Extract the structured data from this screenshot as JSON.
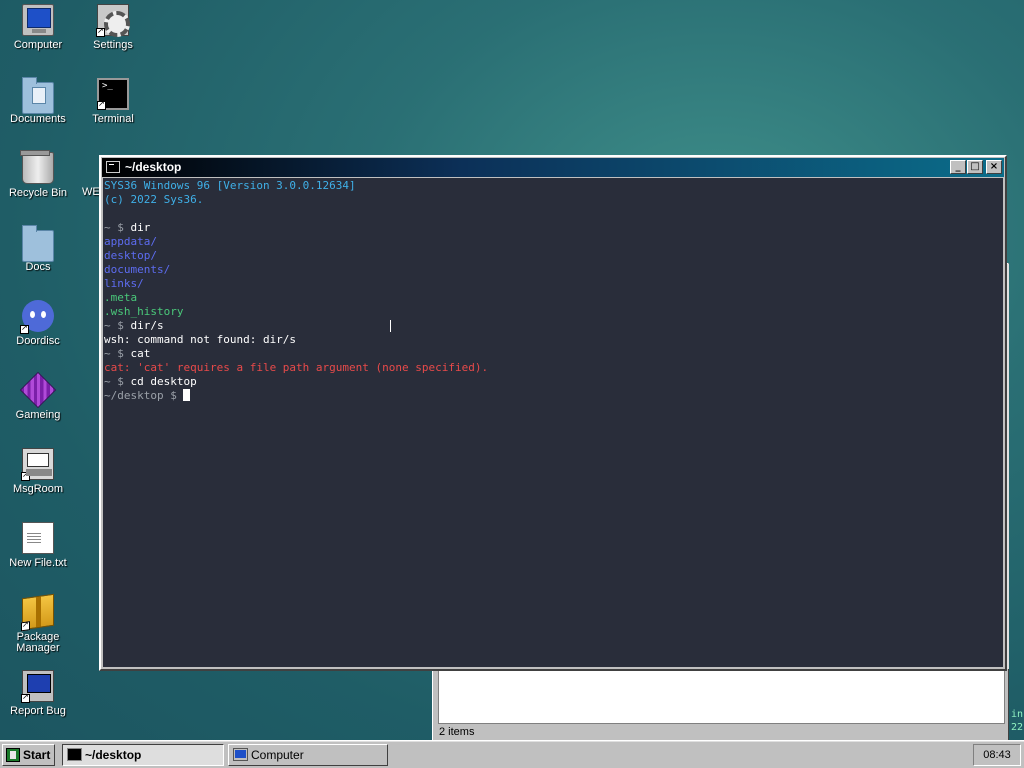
{
  "desktop": {
    "icons": [
      {
        "label": "Computer",
        "icon": "computer-icon"
      },
      {
        "label": "Settings",
        "icon": "settings-icon"
      },
      {
        "label": "Documents",
        "icon": "documents-folder-icon"
      },
      {
        "label": "Terminal",
        "icon": "terminal-icon"
      },
      {
        "label": "Recycle Bin",
        "icon": "recycle-bin-icon"
      },
      {
        "label": "Docs",
        "icon": "folder-icon"
      },
      {
        "label": "Doordisc",
        "icon": "doordisc-icon"
      },
      {
        "label": "Gameing",
        "icon": "game-cube-icon"
      },
      {
        "label": "MsgRoom",
        "icon": "msgroom-icon"
      },
      {
        "label": "New File.txt",
        "icon": "text-file-icon"
      },
      {
        "label": "Package\nManager",
        "icon": "package-icon"
      },
      {
        "label": "Report Bug",
        "icon": "report-bug-icon"
      }
    ],
    "partial_label": "WE",
    "right_edge_text": [
      "in",
      "22"
    ]
  },
  "terminal": {
    "title": "~/desktop",
    "controls": {
      "minimize": "_",
      "maximize": "□",
      "close": "×"
    },
    "lines": [
      {
        "text": "SYS36 Windows 96 [Version 3.0.0.12634]",
        "type": "info"
      },
      {
        "text": "(c) 2022 Sys36.",
        "type": "info"
      },
      {
        "text": "",
        "type": "blank"
      },
      {
        "prompt": "~ $ ",
        "cmd": "dir",
        "type": "command"
      },
      {
        "text": "appdata/",
        "type": "dir"
      },
      {
        "text": "desktop/",
        "type": "dir"
      },
      {
        "text": "documents/",
        "type": "dir"
      },
      {
        "text": "links/",
        "type": "dir"
      },
      {
        "text": ".meta",
        "type": "file"
      },
      {
        "text": ".wsh_history",
        "type": "file"
      },
      {
        "prompt": "~ $ ",
        "cmd": "dir/s",
        "type": "command"
      },
      {
        "text": "wsh: command not found: dir/s",
        "type": "output"
      },
      {
        "prompt": "~ $ ",
        "cmd": "cat",
        "type": "command"
      },
      {
        "text": "cat: 'cat' requires a file path argument (none specified).",
        "type": "error"
      },
      {
        "prompt": "~ $ ",
        "cmd": "cd desktop",
        "type": "command"
      },
      {
        "prompt": "~/desktop $ ",
        "cmd": "",
        "type": "current"
      }
    ]
  },
  "background_window": {
    "status": "2 items"
  },
  "taskbar": {
    "start_label": "Start",
    "tasks": [
      {
        "label": "~/desktop",
        "active": true
      },
      {
        "label": "Computer",
        "active": false
      }
    ],
    "clock": "08:43"
  },
  "colors": {
    "desktop_bg": "#2a6f74",
    "terminal_bg": "#292d3a",
    "info": "#3fb0e8",
    "dir": "#5d6cf0",
    "file": "#4ac87a",
    "error": "#e84a4a"
  }
}
